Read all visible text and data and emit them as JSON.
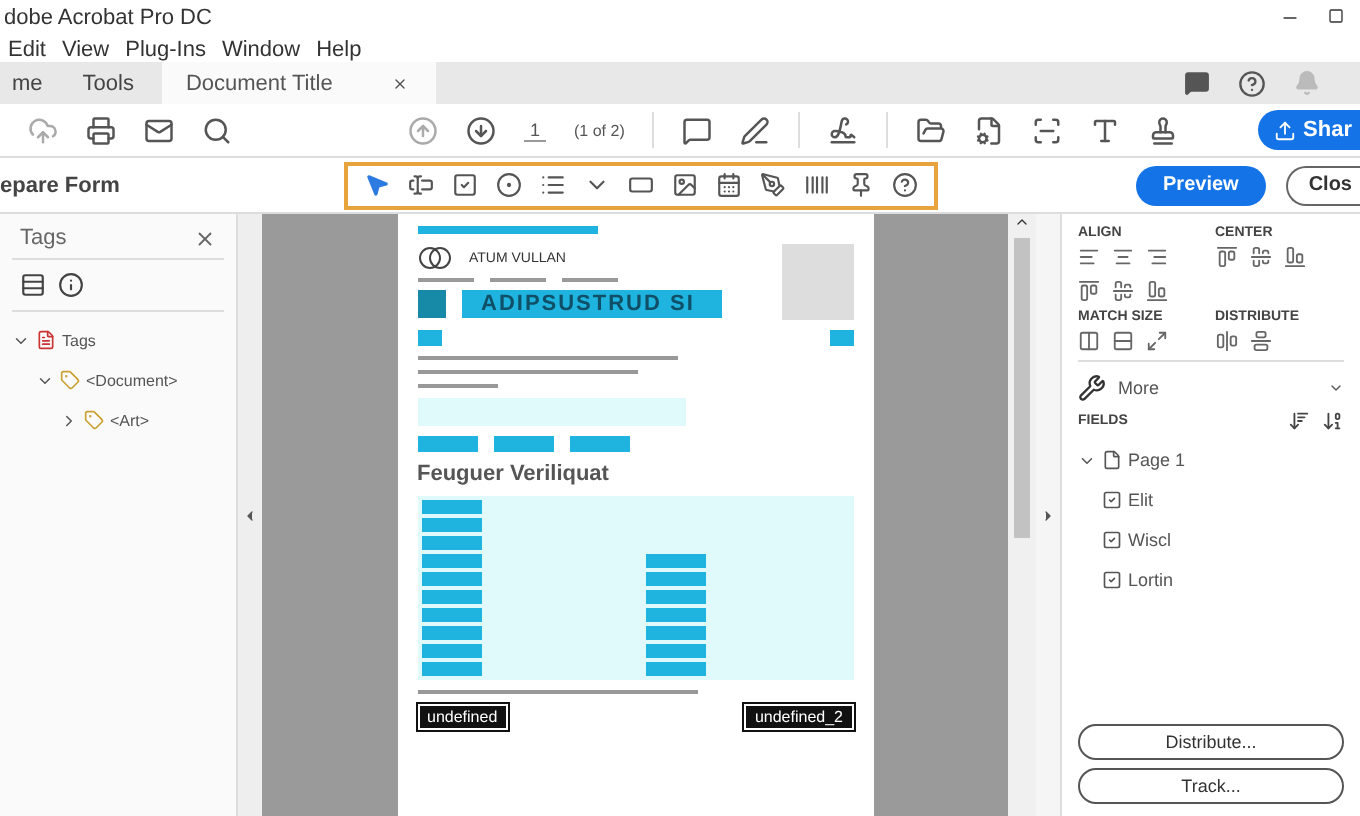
{
  "window": {
    "title": "dobe Acrobat Pro DC"
  },
  "menu": [
    "Edit",
    "View",
    "Plug-Ins",
    "Window",
    "Help"
  ],
  "tabs": [
    {
      "label": "me",
      "selected": false
    },
    {
      "label": "Tools",
      "selected": false
    },
    {
      "label": "Document Title",
      "selected": true
    }
  ],
  "toolbar": {
    "page": "1",
    "page_count": "(1 of 2)",
    "share": "Shar"
  },
  "form_bar": {
    "title": "epare Form",
    "tools": [
      {
        "kind": "pointer",
        "selected": true
      },
      {
        "kind": "text"
      },
      {
        "kind": "checkbox"
      },
      {
        "kind": "radio"
      },
      {
        "kind": "list"
      },
      {
        "kind": "dropdown"
      },
      {
        "kind": "button"
      },
      {
        "kind": "image"
      },
      {
        "kind": "date"
      },
      {
        "kind": "signature"
      },
      {
        "kind": "barcode"
      },
      {
        "kind": "pin"
      },
      {
        "kind": "help"
      }
    ],
    "preview": "Preview",
    "close": "Clos"
  },
  "tags_panel": {
    "title": "Tags",
    "tree": [
      {
        "label": "Tags",
        "kind": "pdf",
        "expanded": true,
        "children": [
          {
            "label": "<Document>",
            "kind": "tag",
            "expanded": true,
            "children": [
              {
                "label": "<Art>",
                "kind": "tag",
                "expanded": false
              }
            ]
          }
        ]
      }
    ]
  },
  "document": {
    "company": "ATUM VULLAN",
    "banner": "ADIPSUSTRUD SI",
    "heading": "Feuguer Veriliquat",
    "fields": [
      "undefined",
      "undefined_2"
    ]
  },
  "right_panel": {
    "sections": [
      {
        "title": "ALIGN"
      },
      {
        "title": "CENTER"
      },
      {
        "title": "MATCH SIZE"
      },
      {
        "title": "DISTRIBUTE"
      }
    ],
    "more": "More",
    "fields_title": "FIELDS",
    "fields": [
      {
        "label": "Page 1",
        "kind": "page",
        "expanded": true,
        "children": [
          {
            "label": "Elit",
            "kind": "checkbox"
          },
          {
            "label": "Wiscl",
            "kind": "checkbox"
          },
          {
            "label": "Lortin",
            "kind": "checkbox"
          }
        ]
      }
    ],
    "buttons": [
      "Distribute...",
      "Track..."
    ]
  }
}
